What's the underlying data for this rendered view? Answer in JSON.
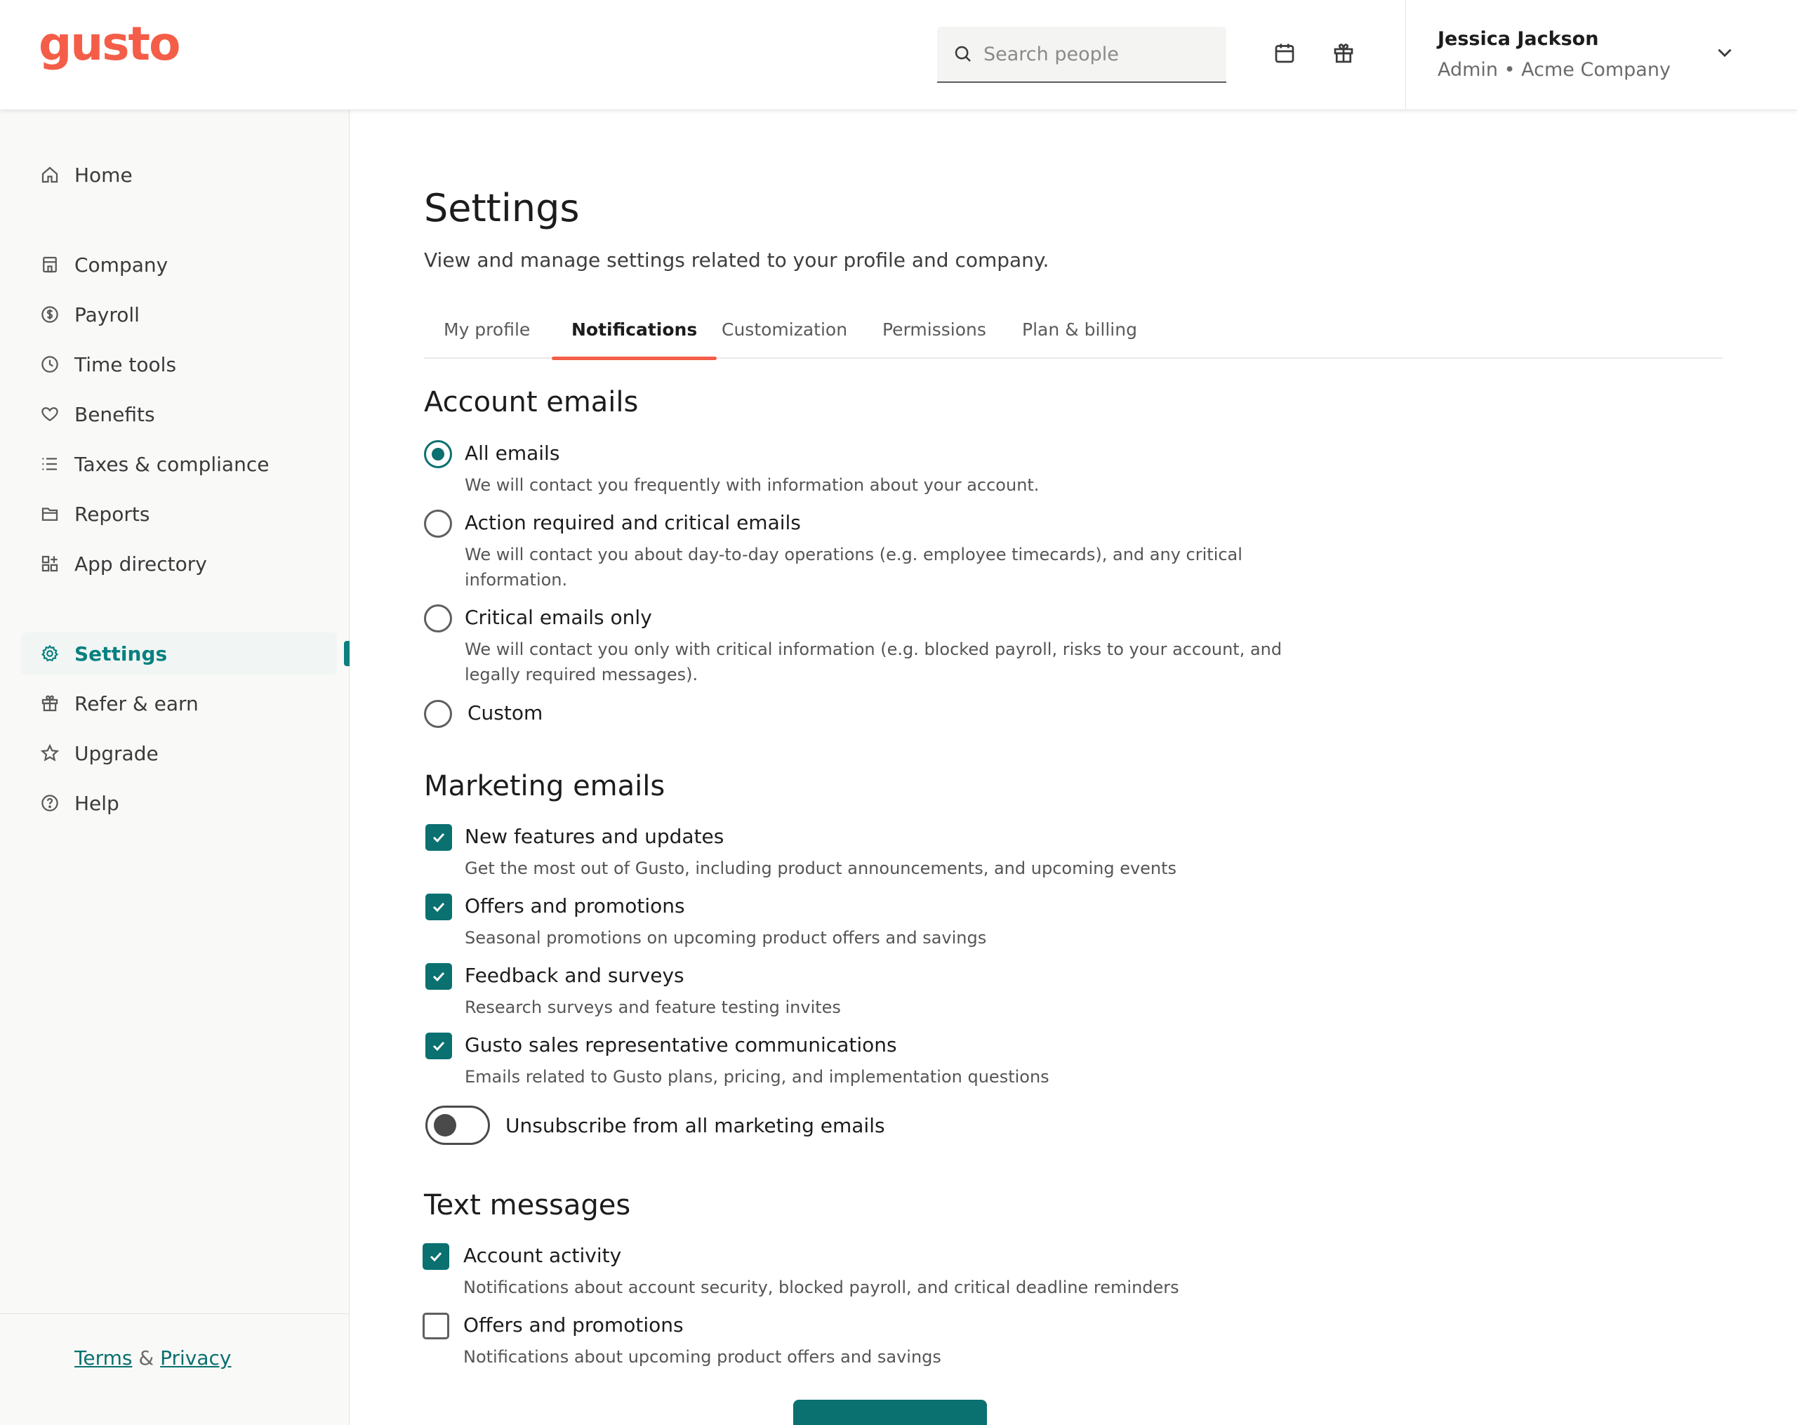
{
  "header": {
    "logo": "gusto",
    "search_placeholder": "Search people",
    "user_name": "Jessica Jackson",
    "user_role": "Admin • Acme Company"
  },
  "sidebar": {
    "items": [
      {
        "label": "Home",
        "icon": "home-icon"
      },
      {
        "label": "Company",
        "icon": "building-icon"
      },
      {
        "label": "Payroll",
        "icon": "dollar-circle-icon"
      },
      {
        "label": "Time tools",
        "icon": "clock-icon"
      },
      {
        "label": "Benefits",
        "icon": "heart-icon"
      },
      {
        "label": "Taxes & compliance",
        "icon": "list-icon"
      },
      {
        "label": "Reports",
        "icon": "folder-icon"
      },
      {
        "label": "App directory",
        "icon": "apps-grid-icon"
      },
      {
        "label": "Settings",
        "icon": "gear-icon",
        "active": true
      },
      {
        "label": "Refer & earn",
        "icon": "gift-icon"
      },
      {
        "label": "Upgrade",
        "icon": "star-icon"
      },
      {
        "label": "Help",
        "icon": "help-circle-icon"
      }
    ],
    "terms": "Terms",
    "amp": "&",
    "privacy": "Privacy"
  },
  "main": {
    "title": "Settings",
    "subtitle": "View and manage settings related to your profile and company.",
    "tabs": [
      "My profile",
      "Notifications",
      "Customization",
      "Permissions",
      "Plan & billing"
    ],
    "active_tab": "Notifications",
    "account_emails": {
      "heading": "Account emails",
      "options": [
        {
          "label": "All emails",
          "desc": "We will contact you frequently with information about your account.",
          "checked": true
        },
        {
          "label": "Action required and critical emails",
          "desc": "We will contact you about day-to-day operations (e.g. employee timecards), and any critical information.",
          "checked": false
        },
        {
          "label": "Critical emails only",
          "desc": "We will contact you only with critical information (e.g. blocked payroll, risks to your account, and legally required messages).",
          "checked": false
        },
        {
          "label": "Custom",
          "desc": "",
          "checked": false
        }
      ]
    },
    "marketing_emails": {
      "heading": "Marketing emails",
      "options": [
        {
          "label": "New features and updates",
          "desc": "Get the most out of Gusto, including product announcements, and upcoming events",
          "checked": true
        },
        {
          "label": "Offers and promotions",
          "desc": "Seasonal promotions on upcoming product offers and savings",
          "checked": true
        },
        {
          "label": "Feedback and surveys",
          "desc": "Research surveys and feature testing invites",
          "checked": true
        },
        {
          "label": "Gusto sales representative communications",
          "desc": "Emails related to Gusto plans, pricing, and implementation questions",
          "checked": true
        }
      ],
      "unsubscribe_label": "Unsubscribe from all marketing emails",
      "unsubscribe_on": false
    },
    "text_messages": {
      "heading": "Text messages",
      "options": [
        {
          "label": "Account activity",
          "desc": "Notifications about account security, blocked payroll, and critical deadline reminders",
          "checked": true
        },
        {
          "label": "Offers and promotions",
          "desc": "Notifications about upcoming product offers and savings",
          "checked": false
        }
      ]
    }
  },
  "colors": {
    "brand": "#f45d48",
    "accent": "#0a7070"
  }
}
